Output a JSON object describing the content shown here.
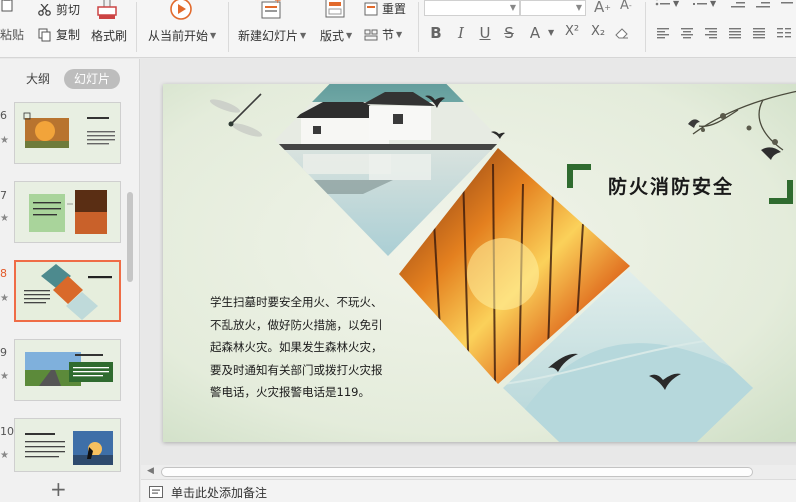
{
  "ribbon": {
    "paste": "粘贴",
    "cut": "剪切",
    "copy": "复制",
    "format_painter": "格式刷",
    "play_from_current": "从当前开始",
    "new_slide": "新建幻灯片",
    "layout": "版式",
    "reset": "重置",
    "section": "节",
    "font_size_up": "A",
    "font_size_down": "A",
    "bold": "B",
    "italic": "I",
    "underline": "U",
    "strike": "S",
    "font_color": "A",
    "superscript": "X²",
    "subscript": "X₂"
  },
  "panel": {
    "tab_outline": "大纲",
    "tab_slides": "幻灯片",
    "slides": [
      {
        "num": "6",
        "active": false
      },
      {
        "num": "7",
        "active": false
      },
      {
        "num": "8",
        "active": true
      },
      {
        "num": "9",
        "active": false
      },
      {
        "num": "10",
        "active": false
      }
    ],
    "add_slide": "+"
  },
  "slide": {
    "title": "防火消防安全",
    "body": "学生扫墓时要安全用火、不玩火、\n不乱放火，做好防火措施，以免引\n起森林火灾。如果发生森林火灾，\n要及时通知有关部门或拨打火灾报\n警电话，火灾报警电话是119。"
  },
  "notes": {
    "placeholder": "单击此处添加备注"
  },
  "colors": {
    "accent_orange": "#ef6c46",
    "slide_green": "#2f6b2f",
    "teal": "#4d8a8e"
  }
}
